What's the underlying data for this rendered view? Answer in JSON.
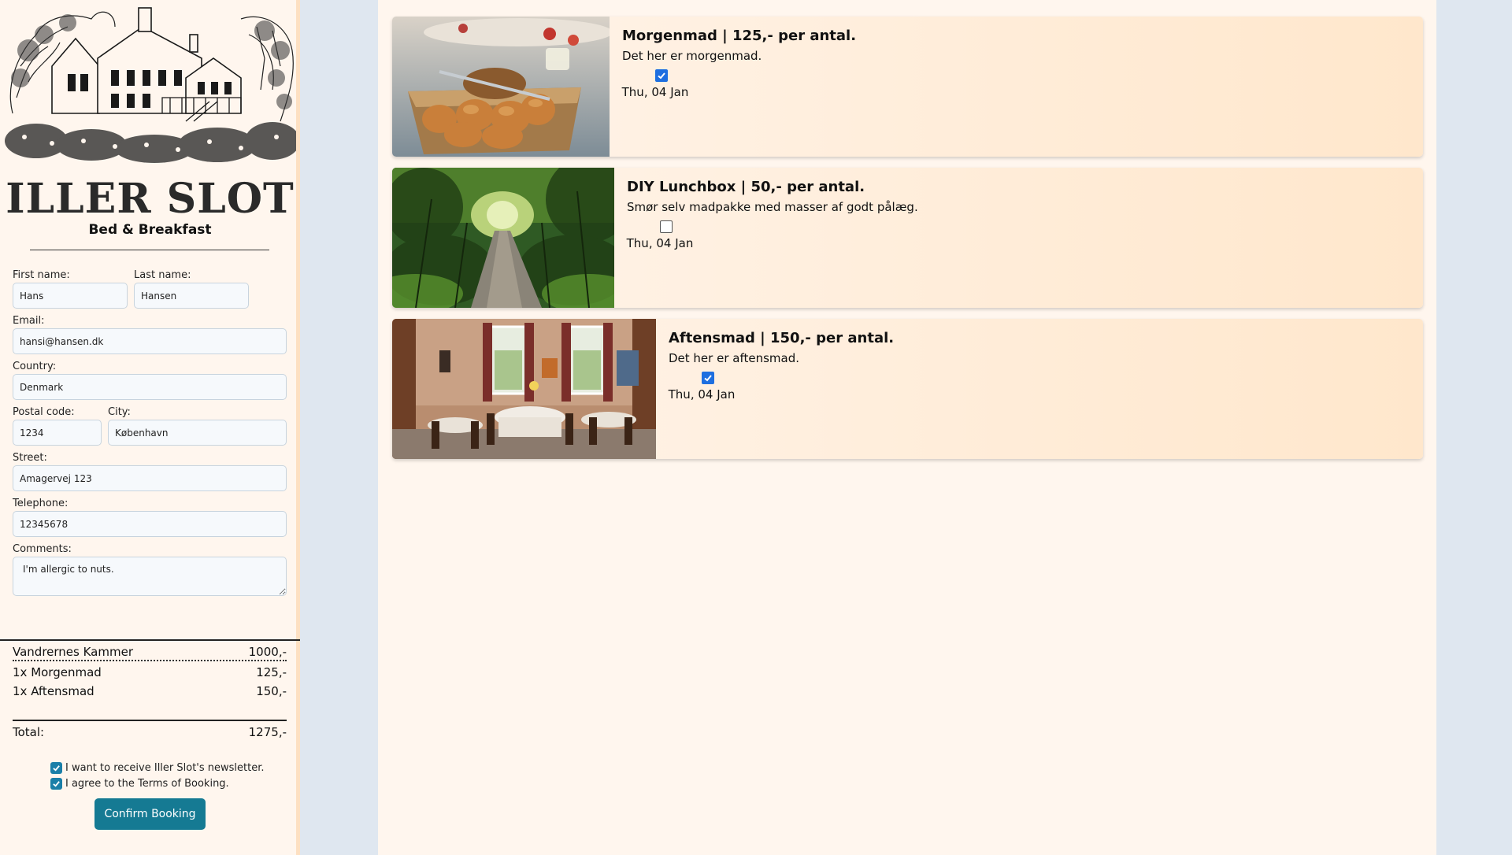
{
  "brand": {
    "title": "ILLER SLOT",
    "subtitle": "Bed & Breakfast"
  },
  "form": {
    "first_name": {
      "label": "First name:",
      "value": "Hans"
    },
    "last_name": {
      "label": "Last name:",
      "value": "Hansen"
    },
    "email": {
      "label": "Email:",
      "value": "hansi@hansen.dk"
    },
    "country": {
      "label": "Country:",
      "value": "Denmark"
    },
    "postal_code": {
      "label": "Postal code:",
      "value": "1234"
    },
    "city": {
      "label": "City:",
      "value": "København"
    },
    "street": {
      "label": "Street:",
      "value": "Amagervej 123"
    },
    "telephone": {
      "label": "Telephone:",
      "value": "12345678"
    },
    "comments": {
      "label": "Comments:",
      "value": "I'm allergic to nuts."
    }
  },
  "summary": {
    "items": [
      {
        "name": "Vandrernes Kammer",
        "price": "1000,-"
      },
      {
        "name": "1x Morgenmad",
        "price": "125,-"
      },
      {
        "name": "1x Aftensmad",
        "price": "150,-"
      }
    ],
    "total_label": "Total:",
    "total_value": "1275,-"
  },
  "consents": {
    "newsletter": {
      "label": "I want to receive Iller Slot's newsletter.",
      "checked": true
    },
    "terms": {
      "label": "I agree to the Terms of Booking.",
      "checked": true
    }
  },
  "confirm_label": "Confirm Booking",
  "colors": {
    "accent": "#157a93",
    "checkbox_blue": "#1e6fe0",
    "sidebar_bg": "#fff6ee",
    "page_bg": "#dfe7f0"
  },
  "meals": [
    {
      "title": "Morgenmad | 125,- per antal.",
      "description": "Det her er morgenmad.",
      "date": "Thu, 04 Jan",
      "selected": true,
      "image": "bread-basket"
    },
    {
      "title": "DIY Lunchbox | 50,- per antal.",
      "description": "Smør selv madpakke med masser af godt pålæg.",
      "date": "Thu, 04 Jan",
      "selected": false,
      "image": "forest-path"
    },
    {
      "title": "Aftensmad | 150,- per antal.",
      "description": "Det her er aftensmad.",
      "date": "Thu, 04 Jan",
      "selected": true,
      "image": "dining-room"
    }
  ]
}
